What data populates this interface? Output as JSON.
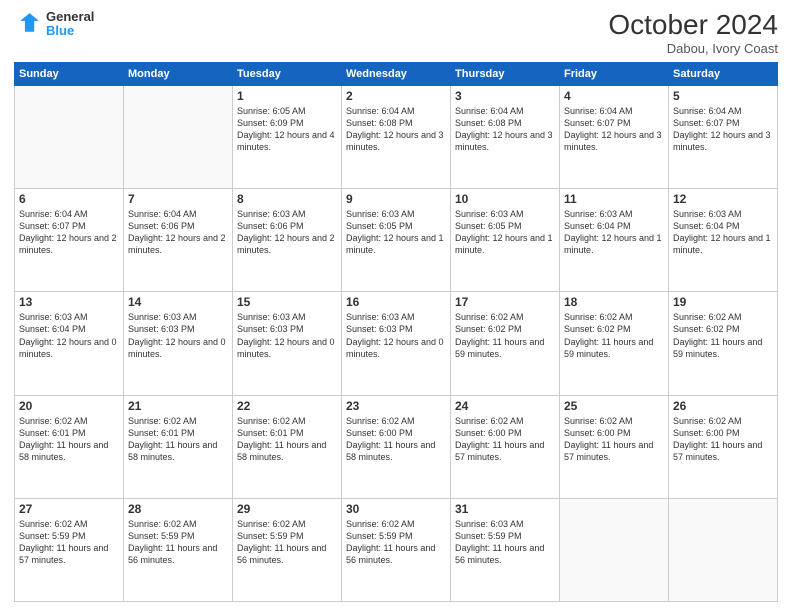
{
  "logo": {
    "line1": "General",
    "line2": "Blue"
  },
  "title": "October 2024",
  "location": "Dabou, Ivory Coast",
  "weekdays": [
    "Sunday",
    "Monday",
    "Tuesday",
    "Wednesday",
    "Thursday",
    "Friday",
    "Saturday"
  ],
  "weeks": [
    [
      {
        "day": "",
        "info": ""
      },
      {
        "day": "",
        "info": ""
      },
      {
        "day": "1",
        "info": "Sunrise: 6:05 AM\nSunset: 6:09 PM\nDaylight: 12 hours and 4 minutes."
      },
      {
        "day": "2",
        "info": "Sunrise: 6:04 AM\nSunset: 6:08 PM\nDaylight: 12 hours and 3 minutes."
      },
      {
        "day": "3",
        "info": "Sunrise: 6:04 AM\nSunset: 6:08 PM\nDaylight: 12 hours and 3 minutes."
      },
      {
        "day": "4",
        "info": "Sunrise: 6:04 AM\nSunset: 6:07 PM\nDaylight: 12 hours and 3 minutes."
      },
      {
        "day": "5",
        "info": "Sunrise: 6:04 AM\nSunset: 6:07 PM\nDaylight: 12 hours and 3 minutes."
      }
    ],
    [
      {
        "day": "6",
        "info": "Sunrise: 6:04 AM\nSunset: 6:07 PM\nDaylight: 12 hours and 2 minutes."
      },
      {
        "day": "7",
        "info": "Sunrise: 6:04 AM\nSunset: 6:06 PM\nDaylight: 12 hours and 2 minutes."
      },
      {
        "day": "8",
        "info": "Sunrise: 6:03 AM\nSunset: 6:06 PM\nDaylight: 12 hours and 2 minutes."
      },
      {
        "day": "9",
        "info": "Sunrise: 6:03 AM\nSunset: 6:05 PM\nDaylight: 12 hours and 1 minute."
      },
      {
        "day": "10",
        "info": "Sunrise: 6:03 AM\nSunset: 6:05 PM\nDaylight: 12 hours and 1 minute."
      },
      {
        "day": "11",
        "info": "Sunrise: 6:03 AM\nSunset: 6:04 PM\nDaylight: 12 hours and 1 minute."
      },
      {
        "day": "12",
        "info": "Sunrise: 6:03 AM\nSunset: 6:04 PM\nDaylight: 12 hours and 1 minute."
      }
    ],
    [
      {
        "day": "13",
        "info": "Sunrise: 6:03 AM\nSunset: 6:04 PM\nDaylight: 12 hours and 0 minutes."
      },
      {
        "day": "14",
        "info": "Sunrise: 6:03 AM\nSunset: 6:03 PM\nDaylight: 12 hours and 0 minutes."
      },
      {
        "day": "15",
        "info": "Sunrise: 6:03 AM\nSunset: 6:03 PM\nDaylight: 12 hours and 0 minutes."
      },
      {
        "day": "16",
        "info": "Sunrise: 6:03 AM\nSunset: 6:03 PM\nDaylight: 12 hours and 0 minutes."
      },
      {
        "day": "17",
        "info": "Sunrise: 6:02 AM\nSunset: 6:02 PM\nDaylight: 11 hours and 59 minutes."
      },
      {
        "day": "18",
        "info": "Sunrise: 6:02 AM\nSunset: 6:02 PM\nDaylight: 11 hours and 59 minutes."
      },
      {
        "day": "19",
        "info": "Sunrise: 6:02 AM\nSunset: 6:02 PM\nDaylight: 11 hours and 59 minutes."
      }
    ],
    [
      {
        "day": "20",
        "info": "Sunrise: 6:02 AM\nSunset: 6:01 PM\nDaylight: 11 hours and 58 minutes."
      },
      {
        "day": "21",
        "info": "Sunrise: 6:02 AM\nSunset: 6:01 PM\nDaylight: 11 hours and 58 minutes."
      },
      {
        "day": "22",
        "info": "Sunrise: 6:02 AM\nSunset: 6:01 PM\nDaylight: 11 hours and 58 minutes."
      },
      {
        "day": "23",
        "info": "Sunrise: 6:02 AM\nSunset: 6:00 PM\nDaylight: 11 hours and 58 minutes."
      },
      {
        "day": "24",
        "info": "Sunrise: 6:02 AM\nSunset: 6:00 PM\nDaylight: 11 hours and 57 minutes."
      },
      {
        "day": "25",
        "info": "Sunrise: 6:02 AM\nSunset: 6:00 PM\nDaylight: 11 hours and 57 minutes."
      },
      {
        "day": "26",
        "info": "Sunrise: 6:02 AM\nSunset: 6:00 PM\nDaylight: 11 hours and 57 minutes."
      }
    ],
    [
      {
        "day": "27",
        "info": "Sunrise: 6:02 AM\nSunset: 5:59 PM\nDaylight: 11 hours and 57 minutes."
      },
      {
        "day": "28",
        "info": "Sunrise: 6:02 AM\nSunset: 5:59 PM\nDaylight: 11 hours and 56 minutes."
      },
      {
        "day": "29",
        "info": "Sunrise: 6:02 AM\nSunset: 5:59 PM\nDaylight: 11 hours and 56 minutes."
      },
      {
        "day": "30",
        "info": "Sunrise: 6:02 AM\nSunset: 5:59 PM\nDaylight: 11 hours and 56 minutes."
      },
      {
        "day": "31",
        "info": "Sunrise: 6:03 AM\nSunset: 5:59 PM\nDaylight: 11 hours and 56 minutes."
      },
      {
        "day": "",
        "info": ""
      },
      {
        "day": "",
        "info": ""
      }
    ]
  ]
}
